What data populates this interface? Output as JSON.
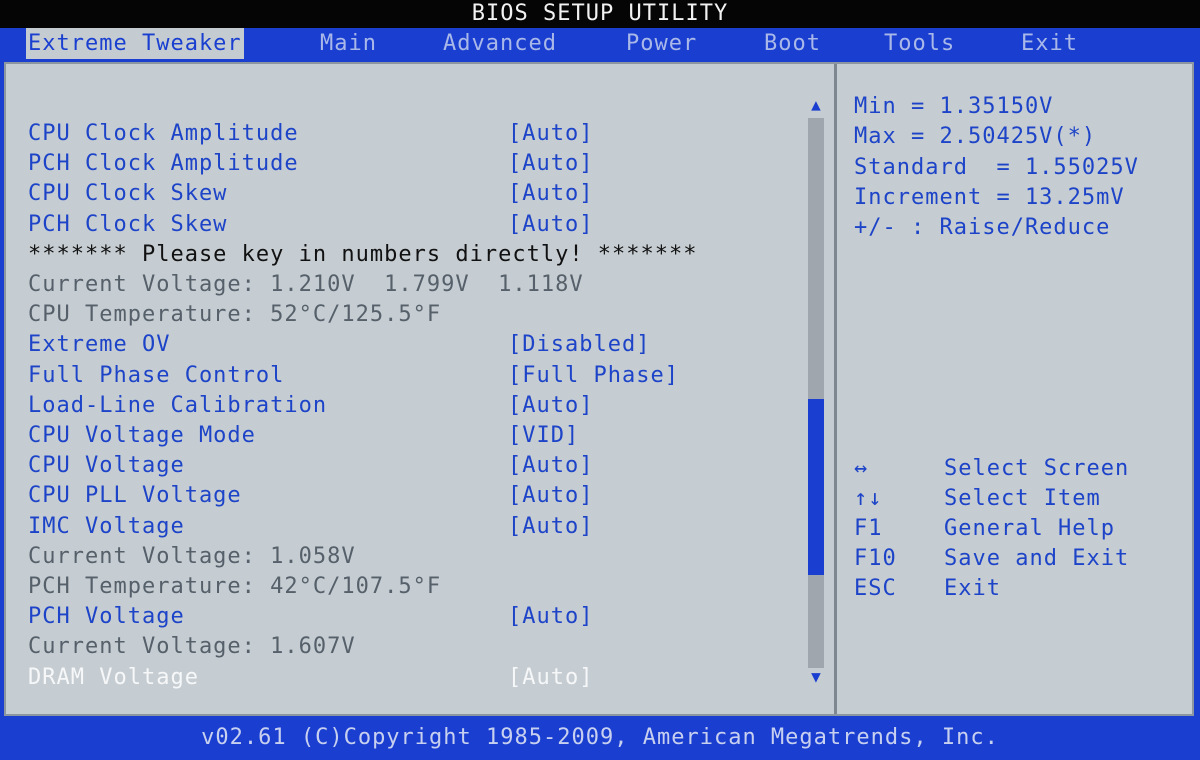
{
  "title": "BIOS SETUP UTILITY",
  "tabs": [
    {
      "label": "Extreme Tweaker",
      "active": true
    },
    {
      "label": "Main"
    },
    {
      "label": "Advanced"
    },
    {
      "label": "Power"
    },
    {
      "label": "Boot"
    },
    {
      "label": "Tools"
    },
    {
      "label": "Exit"
    }
  ],
  "settings": [
    {
      "label": "CPU Clock Amplitude",
      "value": "[Auto]",
      "kind": "setting"
    },
    {
      "label": "PCH Clock Amplitude",
      "value": "[Auto]",
      "kind": "setting"
    },
    {
      "label": "CPU Clock Skew",
      "value": "[Auto]",
      "kind": "setting"
    },
    {
      "label": "PCH Clock Skew",
      "value": "[Auto]",
      "kind": "setting"
    },
    {
      "label": "******* Please key in numbers directly! *******",
      "value": "",
      "kind": "notice"
    },
    {
      "label": "Current Voltage: 1.210V  1.799V  1.118V",
      "value": "",
      "kind": "info"
    },
    {
      "label": "CPU Temperature: 52°C/125.5°F",
      "value": "",
      "kind": "info"
    },
    {
      "label": "Extreme OV",
      "value": "[Disabled]",
      "kind": "setting"
    },
    {
      "label": "Full Phase Control",
      "value": "[Full Phase]",
      "kind": "setting"
    },
    {
      "label": "Load-Line Calibration",
      "value": "[Auto]",
      "kind": "setting"
    },
    {
      "label": "CPU Voltage Mode",
      "value": "[VID]",
      "kind": "setting"
    },
    {
      "label": "CPU Voltage",
      "value": "[Auto]",
      "kind": "setting"
    },
    {
      "label": "CPU PLL Voltage",
      "value": "[Auto]",
      "kind": "setting"
    },
    {
      "label": "IMC Voltage",
      "value": "[Auto]",
      "kind": "setting"
    },
    {
      "label": "Current Voltage: 1.058V",
      "value": "",
      "kind": "info"
    },
    {
      "label": "PCH Temperature: 42°C/107.5°F",
      "value": "",
      "kind": "info"
    },
    {
      "label": "PCH Voltage",
      "value": "[Auto]",
      "kind": "setting"
    },
    {
      "label": "Current Voltage: 1.607V",
      "value": "",
      "kind": "info"
    },
    {
      "label": "DRAM Voltage",
      "value": "[Auto]",
      "kind": "selected"
    }
  ],
  "help": {
    "lines": [
      "Min = 1.35150V",
      "Max = 2.50425V(*)",
      "Standard  = 1.55025V",
      "Increment = 13.25mV",
      "+/- : Raise/Reduce"
    ],
    "keys": [
      {
        "key": "↔",
        "desc": "Select Screen"
      },
      {
        "key": "↑↓",
        "desc": "Select Item"
      },
      {
        "key": "F1",
        "desc": "General Help"
      },
      {
        "key": "F10",
        "desc": "Save and Exit"
      },
      {
        "key": "ESC",
        "desc": "Exit"
      }
    ]
  },
  "scrollbar": {
    "thumb_start": 0.51,
    "thumb_end": 0.83
  },
  "footer": "v02.61 (C)Copyright 1985-2009, American Megatrends, Inc.",
  "colors": {
    "accent": "#1a3fd0",
    "panel": "#c6cdd2",
    "selected_text": "#f6f7f8"
  }
}
